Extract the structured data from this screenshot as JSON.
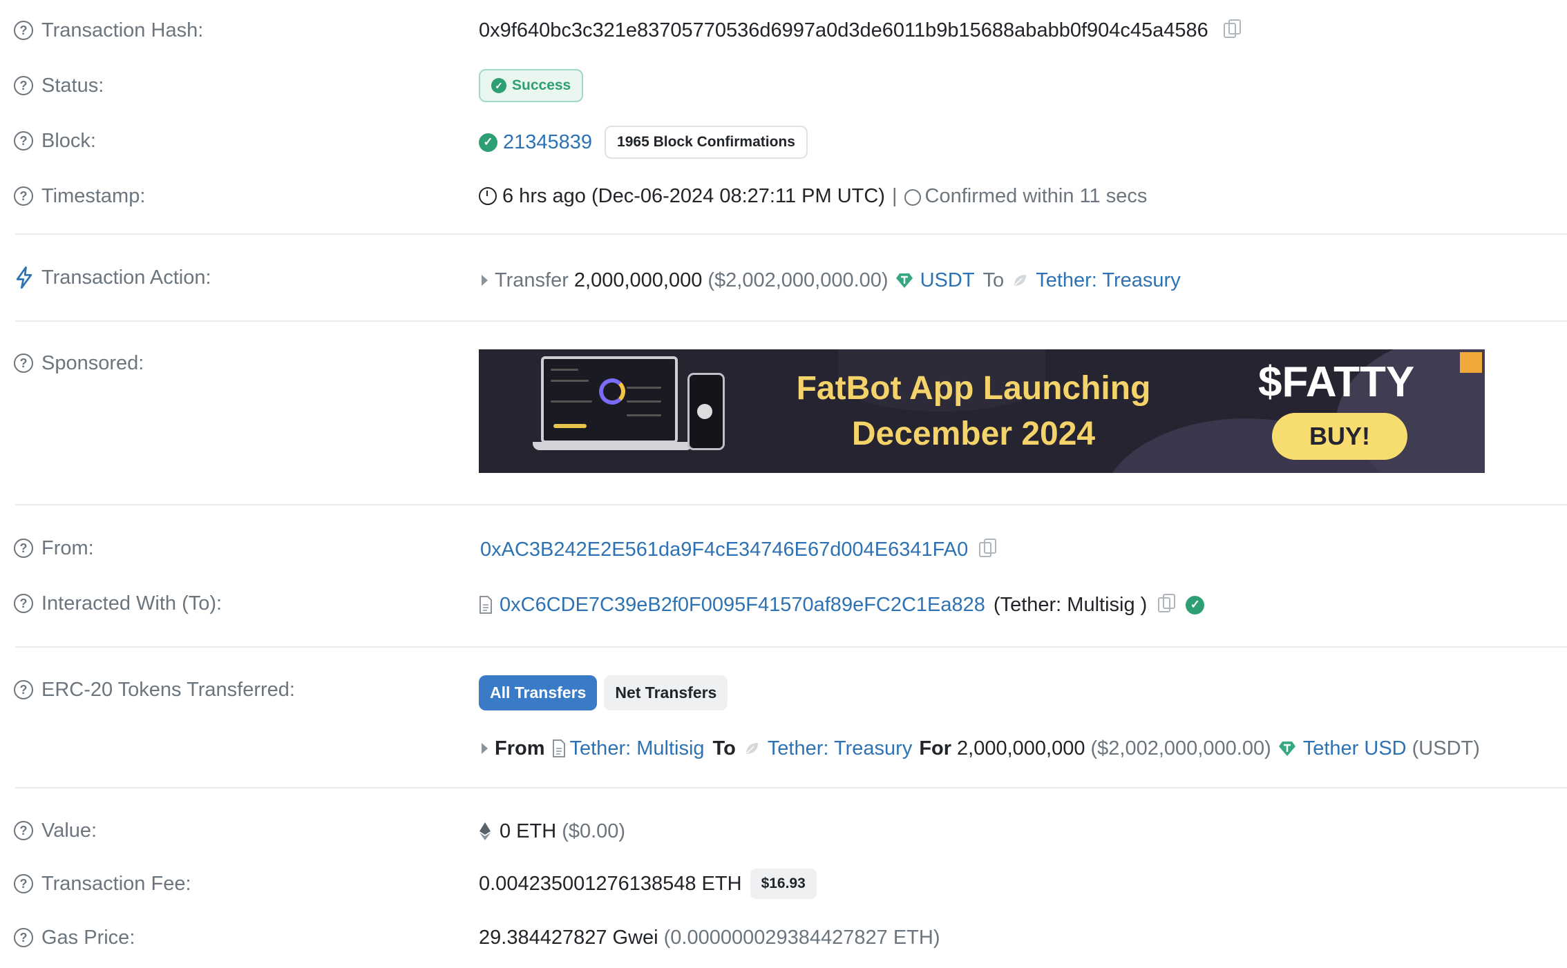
{
  "labels": {
    "tx_hash": "Transaction Hash:",
    "status": "Status:",
    "block": "Block:",
    "timestamp": "Timestamp:",
    "tx_action": "Transaction Action:",
    "sponsored": "Sponsored:",
    "from": "From:",
    "interacted": "Interacted With (To):",
    "erc20": "ERC-20 Tokens Transferred:",
    "value": "Value:",
    "tx_fee": "Transaction Fee:",
    "gas_price": "Gas Price:"
  },
  "tx_hash": "0x9f640bc3c321e83705770536d6997a0d3de6011b9b15688ababb0f904c45a4586",
  "status": "Success",
  "block": {
    "number": "21345839",
    "confirmations": "1965 Block Confirmations"
  },
  "timestamp": {
    "ago": "6 hrs ago (Dec-06-2024 08:27:11 PM UTC)",
    "sep": "|",
    "confirmed": "Confirmed within 11 secs"
  },
  "action": {
    "verb": "Transfer",
    "amount": "2,000,000,000",
    "usd": "($2,002,000,000.00)",
    "token": "USDT",
    "to_word": "To",
    "to": "Tether: Treasury"
  },
  "ad": {
    "title_line1": "FatBot App Launching",
    "title_line2": "December 2024",
    "ticker": "$FATTY",
    "buy": "BUY!"
  },
  "from": "0xAC3B242E2E561da9F4cE34746E67d004E6341FA0",
  "interacted": {
    "address": "0xC6CDE7C39eB2f0F0095F41570af89eFC2C1Ea828",
    "name": "(Tether: Multisig )"
  },
  "erc20": {
    "tabs": [
      "All Transfers",
      "Net Transfers"
    ],
    "from_word": "From",
    "from": "Tether: Multisig",
    "to_word": "To",
    "to": "Tether: Treasury",
    "for_word": "For",
    "amount": "2,000,000,000",
    "usd": "($2,002,000,000.00)",
    "token": "Tether USD",
    "symbol": "(USDT)"
  },
  "value": {
    "eth": "0 ETH",
    "usd": "($0.00)"
  },
  "fee": {
    "eth": "0.004235001276138548 ETH",
    "usd": "$16.93"
  },
  "gas": {
    "gwei": "29.384427827 Gwei",
    "eth": "(0.000000029384427827 ETH)"
  },
  "colors": {
    "link": "#2d72b4",
    "success": "#2e9e74",
    "muted": "#6c757d",
    "primary_button": "#3a7bc8",
    "ad_accent": "#f5d36b"
  }
}
